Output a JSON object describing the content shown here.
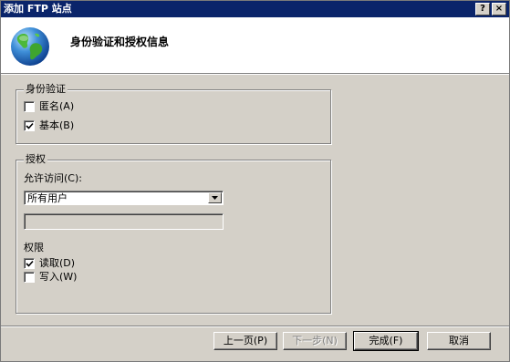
{
  "window": {
    "title": "添加 FTP 站点",
    "help_label": "?",
    "close_label": "×"
  },
  "header": {
    "title": "身份验证和授权信息",
    "icon": "globe-icon"
  },
  "authentication": {
    "legend": "身份验证",
    "anonymous": {
      "label": "匿名(A)",
      "checked": false
    },
    "basic": {
      "label": "基本(B)",
      "checked": true
    }
  },
  "authorization": {
    "legend": "授权",
    "allow_access_label": "允许访问(C):",
    "allow_access_value": "所有用户",
    "user_field_value": "",
    "permissions_label": "权限",
    "read": {
      "label": "读取(D)",
      "checked": true
    },
    "write": {
      "label": "写入(W)",
      "checked": false
    }
  },
  "buttons": {
    "previous": "上一页(P)",
    "next": "下一步(N)",
    "finish": "完成(F)",
    "cancel": "取消"
  },
  "colors": {
    "titlebar": "#0a246a",
    "face": "#d4d0c8",
    "header_bg": "#ffffff"
  }
}
